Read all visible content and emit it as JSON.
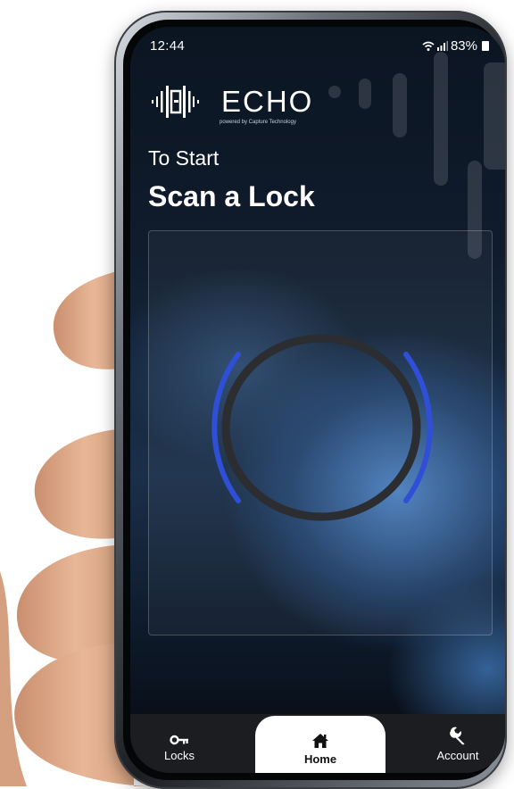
{
  "status_bar": {
    "time": "12:44",
    "battery": "83%"
  },
  "brand": {
    "name": "ECHO",
    "tagline": "powered by Capture Technology"
  },
  "header": {
    "kicker": "To Start",
    "title": "Scan a Lock"
  },
  "nav": {
    "items": [
      {
        "label": "Locks",
        "icon": "key-icon",
        "active": false
      },
      {
        "label": "Home",
        "icon": "home-icon",
        "active": true
      },
      {
        "label": "Account",
        "icon": "wrench-icon",
        "active": false
      }
    ]
  },
  "colors": {
    "accent_blue": "#2f4fd6",
    "nav_bg": "#1c1d20",
    "ring": "#2b2d31"
  }
}
